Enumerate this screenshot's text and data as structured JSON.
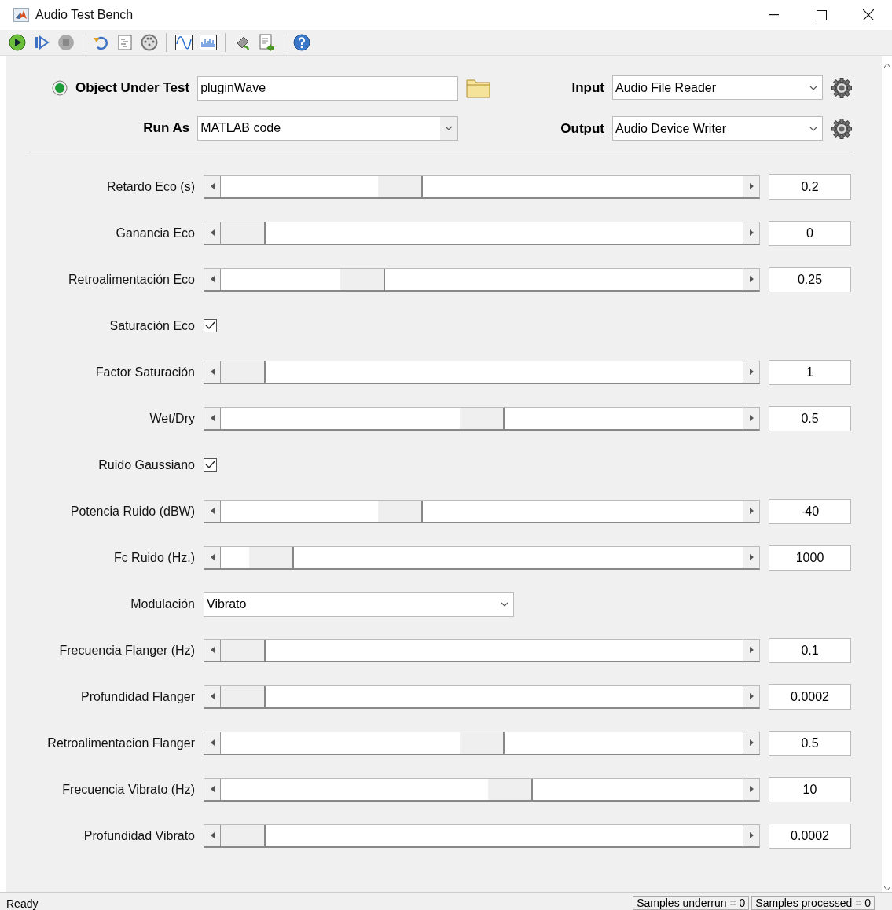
{
  "window": {
    "title": "Audio Test Bench"
  },
  "header": {
    "object_label": "Object Under Test",
    "object_value": "pluginWave",
    "run_as_label": "Run As",
    "run_as_value": "MATLAB code",
    "input_label": "Input",
    "input_value": "Audio File Reader",
    "output_label": "Output",
    "output_value": "Audio Device Writer"
  },
  "parameters": [
    {
      "kind": "slider",
      "label": "Retardo Eco (s)",
      "level": 0.33,
      "value": "0.2"
    },
    {
      "kind": "slider",
      "label": "Ganancia Eco",
      "level": 0,
      "value": "0"
    },
    {
      "kind": "slider",
      "label": "Retroalimentación Eco",
      "level": 0.25,
      "value": "0.25"
    },
    {
      "kind": "checkbox",
      "label": "Saturación Eco",
      "checked": true
    },
    {
      "kind": "slider",
      "label": "Factor Saturación",
      "level": 0,
      "value": "1"
    },
    {
      "kind": "slider",
      "label": "Wet/Dry",
      "level": 0.5,
      "value": "0.5"
    },
    {
      "kind": "checkbox",
      "label": "Ruido Gaussiano",
      "checked": true
    },
    {
      "kind": "slider",
      "label": "Potencia Ruido (dBW)",
      "level": 0.33,
      "value": "-40"
    },
    {
      "kind": "slider",
      "label": "Fc Ruido (Hz.)",
      "level": 0.06,
      "value": "1000"
    },
    {
      "kind": "dropdown",
      "label": "Modulación",
      "value": "Vibrato"
    },
    {
      "kind": "slider",
      "label": "Frecuencia Flanger (Hz)",
      "level": 0,
      "value": "0.1"
    },
    {
      "kind": "slider",
      "label": "Profundidad Flanger",
      "level": 0,
      "value": "0.0002"
    },
    {
      "kind": "slider",
      "label": "Retroalimentacion Flanger",
      "level": 0.5,
      "value": "0.5"
    },
    {
      "kind": "slider",
      "label": "Frecuencia Vibrato (Hz)",
      "level": 0.56,
      "value": "10"
    },
    {
      "kind": "slider",
      "label": "Profundidad Vibrato",
      "level": 0,
      "value": "0.0002"
    }
  ],
  "status_bar": {
    "status": "Ready",
    "underrun": "Samples underrun = 0",
    "processed": "Samples processed = 0"
  }
}
